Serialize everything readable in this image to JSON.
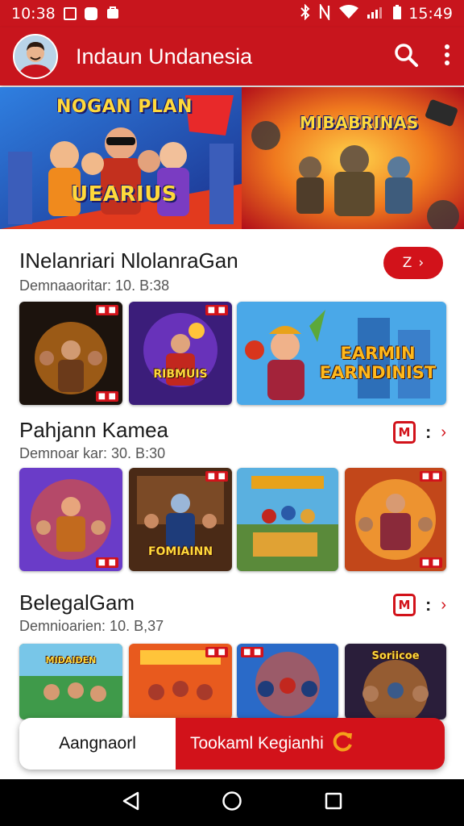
{
  "status_bar": {
    "time_left": "10:38",
    "time_right": "15:49",
    "color": "#c8151d"
  },
  "app_bar": {
    "title": "Indaun Undanesia",
    "icons": [
      "search-icon",
      "more-vert-icon"
    ]
  },
  "banner": {
    "left_title_top": "NOGAN PLAN",
    "left_title_bottom": "UEARIUS",
    "right_title": "MIBABRINAS"
  },
  "sections": [
    {
      "title": "INelanriari NlolanraGan",
      "subtitle": "Demnaaoritar: 10. B:38",
      "more_label": "Z",
      "tiles": [
        "",
        "RIBMUIS",
        "EARMIN EARNDINIST"
      ]
    },
    {
      "title": "Pahjann Kamea",
      "subtitle": "Demnoar kar: 30. B:30",
      "tiles": [
        "",
        "FOMIAINN",
        "",
        ""
      ]
    },
    {
      "title": "BelegalGam",
      "subtitle": "Demnioarien: 10. B,37",
      "tiles": [
        "MIDAIDEN",
        "",
        "",
        "Soriicoe"
      ]
    }
  ],
  "bottom_bar": {
    "left_label": "Aangnaorl",
    "right_label": "Tookaml Kegianhi"
  },
  "nav": [
    "back-icon",
    "home-icon",
    "recents-icon"
  ],
  "colors": {
    "accent": "#d2121a",
    "app_bar": "#c8151d"
  }
}
